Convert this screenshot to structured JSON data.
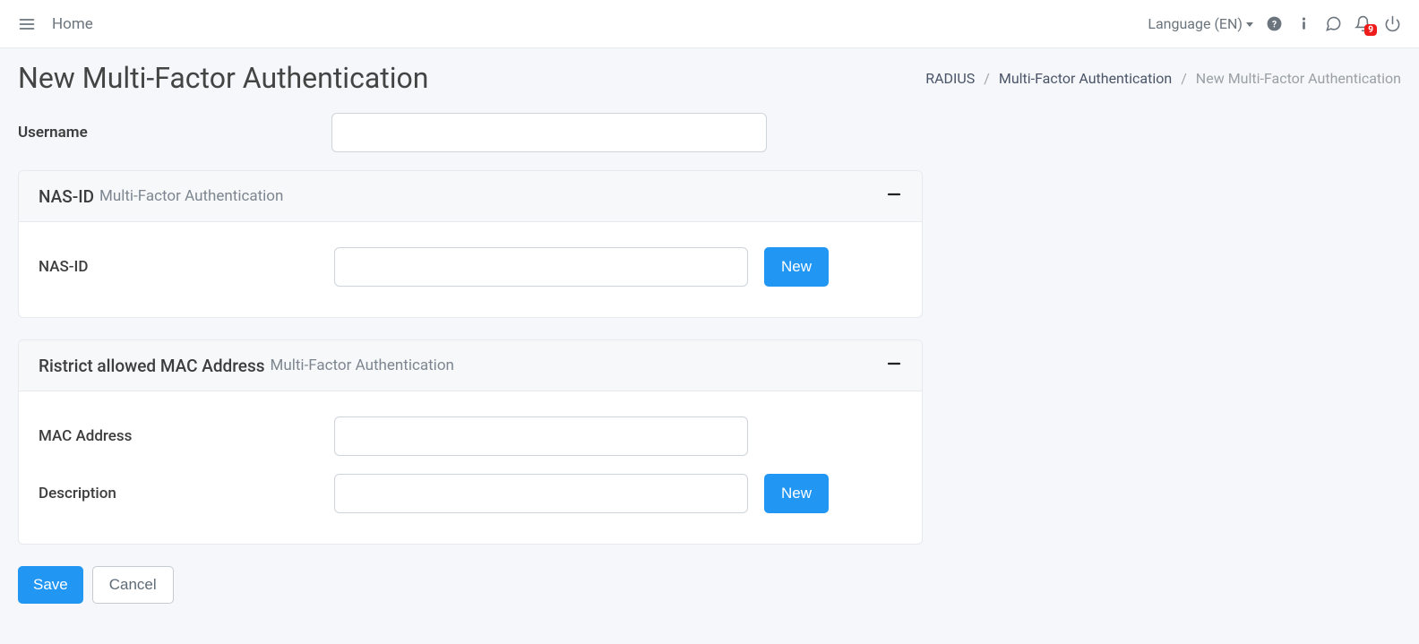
{
  "topbar": {
    "home_label": "Home",
    "language_label": "Language (EN)",
    "notif_count": "9"
  },
  "page": {
    "title": "New Multi-Factor Authentication"
  },
  "breadcrumb": {
    "root": "RADIUS",
    "mid": "Multi-Factor Authentication",
    "current": "New Multi-Factor Authentication"
  },
  "form": {
    "username_label": "Username",
    "username_value": ""
  },
  "card_nasid": {
    "title": "NAS-ID",
    "subtitle": "Multi-Factor Authentication",
    "field_label": "NAS-ID",
    "field_value": "",
    "new_button": "New"
  },
  "card_mac": {
    "title": "Ristrict allowed MAC Address",
    "subtitle": "Multi-Factor Authentication",
    "mac_label": "MAC Address",
    "mac_value": "",
    "desc_label": "Description",
    "desc_value": "",
    "new_button": "New"
  },
  "actions": {
    "save": "Save",
    "cancel": "Cancel"
  }
}
